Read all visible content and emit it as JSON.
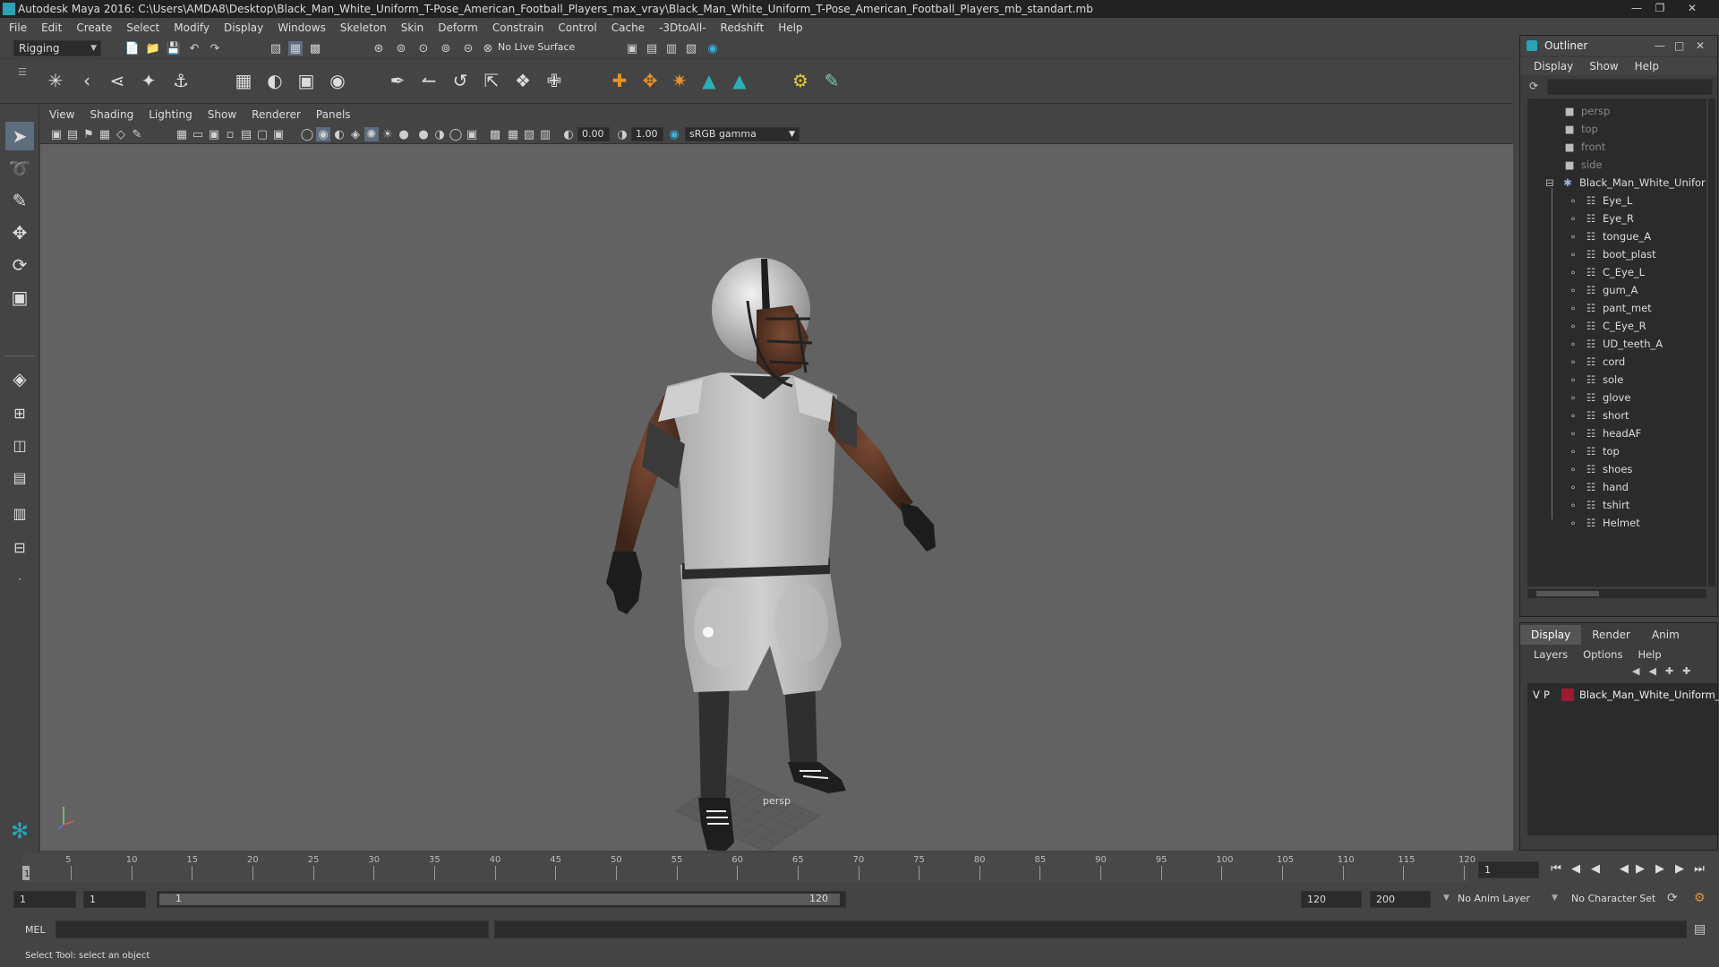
{
  "window": {
    "title": "Autodesk Maya 2016: C:\\Users\\AMDA8\\Desktop\\Black_Man_White_Uniform_T-Pose_American_Football_Players_max_vray\\Black_Man_White_Uniform_T-Pose_American_Football_Players_mb_standart.mb"
  },
  "menubar": [
    "File",
    "Edit",
    "Create",
    "Select",
    "Modify",
    "Display",
    "Windows",
    "Skeleton",
    "Skin",
    "Deform",
    "Constrain",
    "Control",
    "Cache",
    "-3DtoAll-",
    "Redshift",
    "Help"
  ],
  "statusline": {
    "mode": "Rigging",
    "live_surface": "No Live Surface"
  },
  "viewport": {
    "menu": [
      "View",
      "Shading",
      "Lighting",
      "Show",
      "Renderer",
      "Panels"
    ],
    "exposure": "0.00",
    "gamma": "1.00",
    "color_space": "sRGB gamma",
    "camera_label": "persp"
  },
  "outliner": {
    "title": "Outliner",
    "menu": [
      "Display",
      "Show",
      "Help"
    ],
    "cameras": [
      "persp",
      "top",
      "front",
      "side"
    ],
    "group": "Black_Man_White_Unifor",
    "children": [
      "Eye_L",
      "Eye_R",
      "tongue_A",
      "boot_plast",
      "C_Eye_L",
      "gum_A",
      "pant_met",
      "C_Eye_R",
      "UD_teeth_A",
      "cord",
      "sole",
      "glove",
      "short",
      "headAF",
      "top",
      "shoes",
      "hand",
      "tshirt",
      "Helmet"
    ]
  },
  "layers": {
    "tabs": [
      "Display",
      "Render",
      "Anim"
    ],
    "menu": [
      "Layers",
      "Options",
      "Help"
    ],
    "layer": {
      "v": "V",
      "p": "P",
      "name": "Black_Man_White_Uniform_T",
      "color": "#9b1b30"
    }
  },
  "timeline": {
    "ticks": [
      "5",
      "10",
      "15",
      "20",
      "25",
      "30",
      "35",
      "40",
      "45",
      "50",
      "55",
      "60",
      "65",
      "70",
      "75",
      "80",
      "85",
      "90",
      "95",
      "100",
      "105",
      "110",
      "115",
      "120"
    ],
    "current_frame": "1",
    "frame_field": "1"
  },
  "range": {
    "start": "1",
    "playback_start": "1",
    "slider_start": "1",
    "slider_end": "120",
    "playback_end": "120",
    "end": "200",
    "anim_layer": "No Anim Layer",
    "character_set": "No Character Set"
  },
  "cmdline": {
    "label": "MEL"
  },
  "helpline": {
    "text": "Select Tool: select an object"
  }
}
